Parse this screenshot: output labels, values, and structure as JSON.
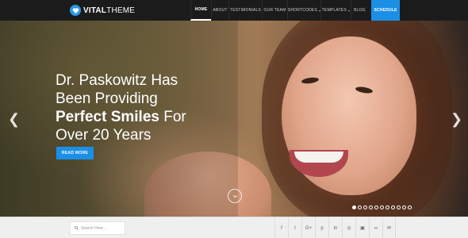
{
  "brand": {
    "name_bold": "VITAL",
    "name_light": "THEME"
  },
  "nav": {
    "items": [
      {
        "label": "HOME",
        "active": true,
        "width": 26,
        "dropdown": false
      },
      {
        "label": "ABOUT",
        "active": false,
        "width": 22,
        "dropdown": false
      },
      {
        "label": "TESTIMONIALS",
        "active": false,
        "width": 42,
        "dropdown": false
      },
      {
        "label": "OUR TEAM",
        "active": false,
        "width": 32,
        "dropdown": false
      },
      {
        "label": "SHORTCODES",
        "active": false,
        "width": 42,
        "dropdown": true
      },
      {
        "label": "TEMPLATES",
        "active": false,
        "width": 38,
        "dropdown": true
      },
      {
        "label": "BLOG",
        "active": false,
        "width": 22,
        "dropdown": false
      }
    ],
    "schedule_label": "SCHEDULE"
  },
  "hero": {
    "line1": "Dr. Paskowitz Has",
    "line2": "Been Providing",
    "line3_bold": "Perfect Smiles",
    "line3_rest": " For",
    "line4": "Over 20 Years",
    "cta_label": "READ MORE"
  },
  "slider": {
    "dot_count": 11,
    "active_index": 0
  },
  "search": {
    "placeholder": "Search Here ..."
  },
  "social": [
    {
      "icon": "facebook-icon",
      "glyph": "f"
    },
    {
      "icon": "twitter-icon",
      "glyph": "t"
    },
    {
      "icon": "google-plus-icon",
      "glyph": "G+"
    },
    {
      "icon": "pinterest-icon",
      "glyph": "p"
    },
    {
      "icon": "linkedin-icon",
      "glyph": "in"
    },
    {
      "icon": "instagram-icon",
      "glyph": "◎"
    },
    {
      "icon": "flickr-icon",
      "glyph": "▣"
    },
    {
      "icon": "link-icon",
      "glyph": "∞"
    },
    {
      "icon": "email-icon",
      "glyph": "✉"
    }
  ],
  "colors": {
    "accent": "#1b8fe6",
    "header_bg": "#1b1b1b",
    "footer_bg": "#efefef"
  }
}
